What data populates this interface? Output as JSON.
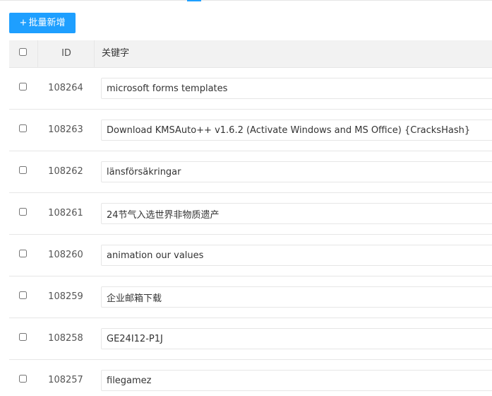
{
  "toolbar": {
    "batch_add_label": "批量新增",
    "batch_add_icon": "plus-icon"
  },
  "table": {
    "headers": {
      "id": "ID",
      "keyword": "关键字"
    },
    "rows": [
      {
        "id": "108264",
        "keyword": "microsoft forms templates"
      },
      {
        "id": "108263",
        "keyword": "Download KMSAuto++ v1.6.2 (Activate Windows and MS Office) {CracksHash}"
      },
      {
        "id": "108262",
        "keyword": "länsförsäkringar"
      },
      {
        "id": "108261",
        "keyword": "24节气入选世界非物质遗产"
      },
      {
        "id": "108260",
        "keyword": "animation our values"
      },
      {
        "id": "108259",
        "keyword": "企业邮箱下载"
      },
      {
        "id": "108258",
        "keyword": "GE24I12-P1J"
      },
      {
        "id": "108257",
        "keyword": "filegamez"
      }
    ]
  },
  "colors": {
    "accent": "#1e9fff",
    "header_bg": "#f2f2f2",
    "border": "#e6e6e6"
  }
}
